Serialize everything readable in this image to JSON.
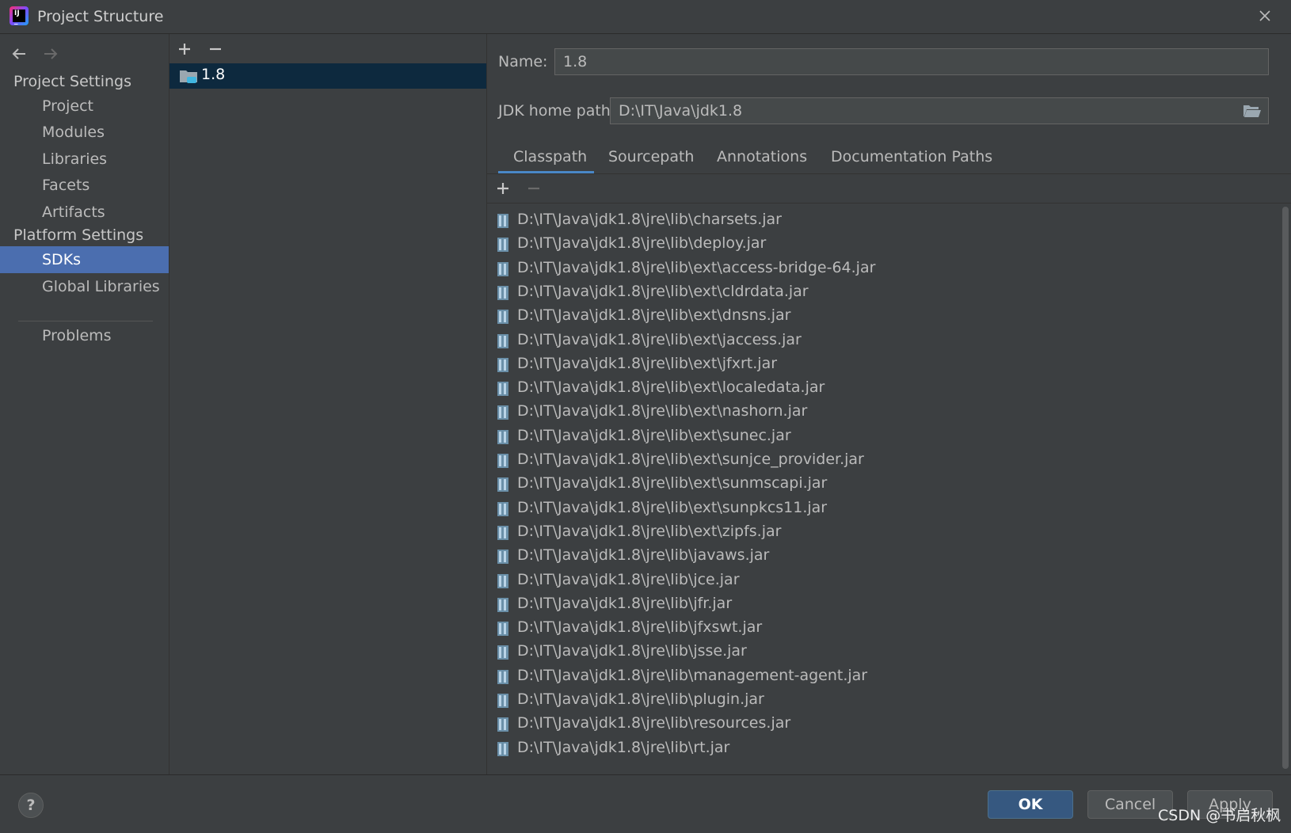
{
  "window": {
    "title": "Project Structure"
  },
  "sidebar": {
    "project_settings_label": "Project Settings",
    "platform_settings_label": "Platform Settings",
    "items": [
      {
        "label": "Project"
      },
      {
        "label": "Modules"
      },
      {
        "label": "Libraries"
      },
      {
        "label": "Facets"
      },
      {
        "label": "Artifacts"
      },
      {
        "label": "SDKs"
      },
      {
        "label": "Global Libraries"
      },
      {
        "label": "Problems"
      }
    ],
    "selected": "SDKs"
  },
  "sdk_list": {
    "items": [
      {
        "label": "1.8"
      }
    ]
  },
  "detail": {
    "name_label": "Name:",
    "name_value": "1.8",
    "jdk_path_label": "JDK home path:",
    "jdk_path_value": "D:\\IT\\Java\\jdk1.8",
    "tabs": [
      "Classpath",
      "Sourcepath",
      "Annotations",
      "Documentation Paths"
    ],
    "active_tab": "Classpath"
  },
  "classpath": [
    "D:\\IT\\Java\\jdk1.8\\jre\\lib\\charsets.jar",
    "D:\\IT\\Java\\jdk1.8\\jre\\lib\\deploy.jar",
    "D:\\IT\\Java\\jdk1.8\\jre\\lib\\ext\\access-bridge-64.jar",
    "D:\\IT\\Java\\jdk1.8\\jre\\lib\\ext\\cldrdata.jar",
    "D:\\IT\\Java\\jdk1.8\\jre\\lib\\ext\\dnsns.jar",
    "D:\\IT\\Java\\jdk1.8\\jre\\lib\\ext\\jaccess.jar",
    "D:\\IT\\Java\\jdk1.8\\jre\\lib\\ext\\jfxrt.jar",
    "D:\\IT\\Java\\jdk1.8\\jre\\lib\\ext\\localedata.jar",
    "D:\\IT\\Java\\jdk1.8\\jre\\lib\\ext\\nashorn.jar",
    "D:\\IT\\Java\\jdk1.8\\jre\\lib\\ext\\sunec.jar",
    "D:\\IT\\Java\\jdk1.8\\jre\\lib\\ext\\sunjce_provider.jar",
    "D:\\IT\\Java\\jdk1.8\\jre\\lib\\ext\\sunmscapi.jar",
    "D:\\IT\\Java\\jdk1.8\\jre\\lib\\ext\\sunpkcs11.jar",
    "D:\\IT\\Java\\jdk1.8\\jre\\lib\\ext\\zipfs.jar",
    "D:\\IT\\Java\\jdk1.8\\jre\\lib\\javaws.jar",
    "D:\\IT\\Java\\jdk1.8\\jre\\lib\\jce.jar",
    "D:\\IT\\Java\\jdk1.8\\jre\\lib\\jfr.jar",
    "D:\\IT\\Java\\jdk1.8\\jre\\lib\\jfxswt.jar",
    "D:\\IT\\Java\\jdk1.8\\jre\\lib\\jsse.jar",
    "D:\\IT\\Java\\jdk1.8\\jre\\lib\\management-agent.jar",
    "D:\\IT\\Java\\jdk1.8\\jre\\lib\\plugin.jar",
    "D:\\IT\\Java\\jdk1.8\\jre\\lib\\resources.jar",
    "D:\\IT\\Java\\jdk1.8\\jre\\lib\\rt.jar"
  ],
  "footer": {
    "help_label": "?",
    "ok_label": "OK",
    "cancel_label": "Cancel",
    "apply_label": "Apply",
    "watermark": "CSDN @书启秋枫"
  },
  "colors": {
    "background": "#3c3f41",
    "selection": "#4b6eaf",
    "accent": "#4a88c7",
    "ok_button": "#365880"
  }
}
